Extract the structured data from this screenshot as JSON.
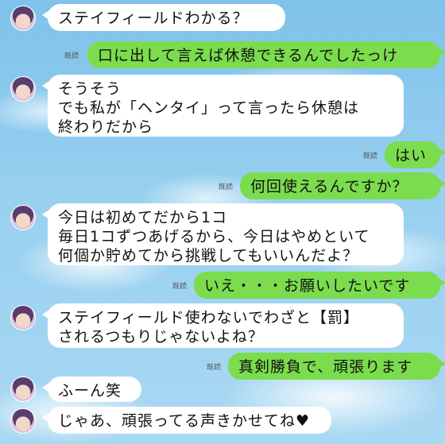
{
  "read_label": "既読",
  "messages": [
    {
      "side": "in",
      "text": "ステイフィールドわかる？"
    },
    {
      "side": "out",
      "text": "口に出して言えば休憩できるんでしたっけ"
    },
    {
      "side": "in",
      "text": "そうそう\nでも私が「ヘンタイ」って言ったら休憩は\n終わりだから"
    },
    {
      "side": "out",
      "text": "はい"
    },
    {
      "side": "out",
      "text": "何回使えるんですか？"
    },
    {
      "side": "in",
      "text": "今日は初めてだから1コ\n毎日1コずつあげるから、今日はやめといて\n何個か貯めてから挑戦してもいいんだよ？"
    },
    {
      "side": "out",
      "text": "いえ・・・お願いしたいです"
    },
    {
      "side": "in",
      "text": "ステイフィールド使わないでわざと【罰】\nされるつもりじゃないよね？"
    },
    {
      "side": "out",
      "text": "真剣勝負で、頑張ります"
    },
    {
      "side": "in",
      "text": "ふーん笑"
    },
    {
      "side": "in",
      "text": "じゃあ、頑張ってる声きかせてね♥"
    }
  ]
}
